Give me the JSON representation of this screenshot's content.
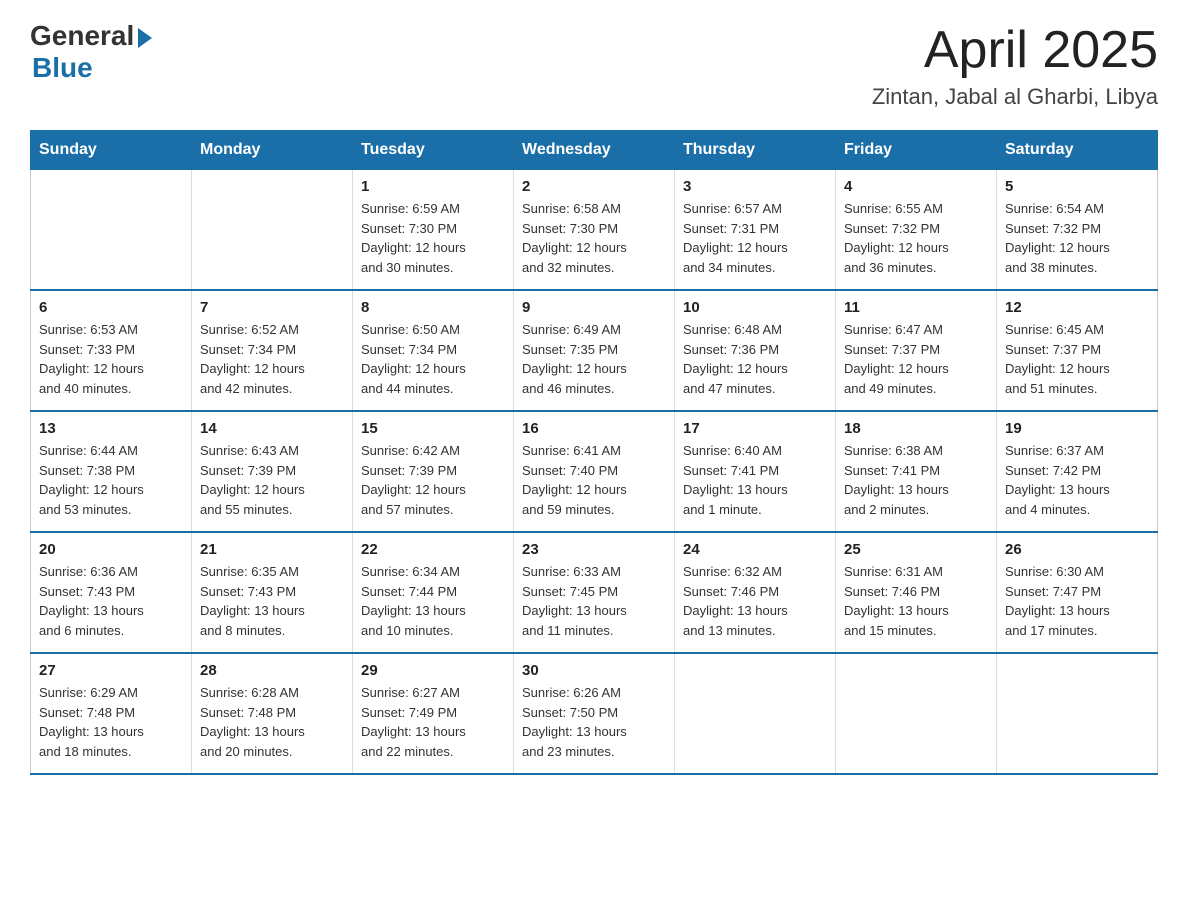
{
  "logo": {
    "general": "General",
    "blue": "Blue"
  },
  "header": {
    "month_year": "April 2025",
    "location": "Zintan, Jabal al Gharbi, Libya"
  },
  "days_of_week": [
    "Sunday",
    "Monday",
    "Tuesday",
    "Wednesday",
    "Thursday",
    "Friday",
    "Saturday"
  ],
  "weeks": [
    [
      {
        "day": "",
        "info": ""
      },
      {
        "day": "",
        "info": ""
      },
      {
        "day": "1",
        "info": "Sunrise: 6:59 AM\nSunset: 7:30 PM\nDaylight: 12 hours\nand 30 minutes."
      },
      {
        "day": "2",
        "info": "Sunrise: 6:58 AM\nSunset: 7:30 PM\nDaylight: 12 hours\nand 32 minutes."
      },
      {
        "day": "3",
        "info": "Sunrise: 6:57 AM\nSunset: 7:31 PM\nDaylight: 12 hours\nand 34 minutes."
      },
      {
        "day": "4",
        "info": "Sunrise: 6:55 AM\nSunset: 7:32 PM\nDaylight: 12 hours\nand 36 minutes."
      },
      {
        "day": "5",
        "info": "Sunrise: 6:54 AM\nSunset: 7:32 PM\nDaylight: 12 hours\nand 38 minutes."
      }
    ],
    [
      {
        "day": "6",
        "info": "Sunrise: 6:53 AM\nSunset: 7:33 PM\nDaylight: 12 hours\nand 40 minutes."
      },
      {
        "day": "7",
        "info": "Sunrise: 6:52 AM\nSunset: 7:34 PM\nDaylight: 12 hours\nand 42 minutes."
      },
      {
        "day": "8",
        "info": "Sunrise: 6:50 AM\nSunset: 7:34 PM\nDaylight: 12 hours\nand 44 minutes."
      },
      {
        "day": "9",
        "info": "Sunrise: 6:49 AM\nSunset: 7:35 PM\nDaylight: 12 hours\nand 46 minutes."
      },
      {
        "day": "10",
        "info": "Sunrise: 6:48 AM\nSunset: 7:36 PM\nDaylight: 12 hours\nand 47 minutes."
      },
      {
        "day": "11",
        "info": "Sunrise: 6:47 AM\nSunset: 7:37 PM\nDaylight: 12 hours\nand 49 minutes."
      },
      {
        "day": "12",
        "info": "Sunrise: 6:45 AM\nSunset: 7:37 PM\nDaylight: 12 hours\nand 51 minutes."
      }
    ],
    [
      {
        "day": "13",
        "info": "Sunrise: 6:44 AM\nSunset: 7:38 PM\nDaylight: 12 hours\nand 53 minutes."
      },
      {
        "day": "14",
        "info": "Sunrise: 6:43 AM\nSunset: 7:39 PM\nDaylight: 12 hours\nand 55 minutes."
      },
      {
        "day": "15",
        "info": "Sunrise: 6:42 AM\nSunset: 7:39 PM\nDaylight: 12 hours\nand 57 minutes."
      },
      {
        "day": "16",
        "info": "Sunrise: 6:41 AM\nSunset: 7:40 PM\nDaylight: 12 hours\nand 59 minutes."
      },
      {
        "day": "17",
        "info": "Sunrise: 6:40 AM\nSunset: 7:41 PM\nDaylight: 13 hours\nand 1 minute."
      },
      {
        "day": "18",
        "info": "Sunrise: 6:38 AM\nSunset: 7:41 PM\nDaylight: 13 hours\nand 2 minutes."
      },
      {
        "day": "19",
        "info": "Sunrise: 6:37 AM\nSunset: 7:42 PM\nDaylight: 13 hours\nand 4 minutes."
      }
    ],
    [
      {
        "day": "20",
        "info": "Sunrise: 6:36 AM\nSunset: 7:43 PM\nDaylight: 13 hours\nand 6 minutes."
      },
      {
        "day": "21",
        "info": "Sunrise: 6:35 AM\nSunset: 7:43 PM\nDaylight: 13 hours\nand 8 minutes."
      },
      {
        "day": "22",
        "info": "Sunrise: 6:34 AM\nSunset: 7:44 PM\nDaylight: 13 hours\nand 10 minutes."
      },
      {
        "day": "23",
        "info": "Sunrise: 6:33 AM\nSunset: 7:45 PM\nDaylight: 13 hours\nand 11 minutes."
      },
      {
        "day": "24",
        "info": "Sunrise: 6:32 AM\nSunset: 7:46 PM\nDaylight: 13 hours\nand 13 minutes."
      },
      {
        "day": "25",
        "info": "Sunrise: 6:31 AM\nSunset: 7:46 PM\nDaylight: 13 hours\nand 15 minutes."
      },
      {
        "day": "26",
        "info": "Sunrise: 6:30 AM\nSunset: 7:47 PM\nDaylight: 13 hours\nand 17 minutes."
      }
    ],
    [
      {
        "day": "27",
        "info": "Sunrise: 6:29 AM\nSunset: 7:48 PM\nDaylight: 13 hours\nand 18 minutes."
      },
      {
        "day": "28",
        "info": "Sunrise: 6:28 AM\nSunset: 7:48 PM\nDaylight: 13 hours\nand 20 minutes."
      },
      {
        "day": "29",
        "info": "Sunrise: 6:27 AM\nSunset: 7:49 PM\nDaylight: 13 hours\nand 22 minutes."
      },
      {
        "day": "30",
        "info": "Sunrise: 6:26 AM\nSunset: 7:50 PM\nDaylight: 13 hours\nand 23 minutes."
      },
      {
        "day": "",
        "info": ""
      },
      {
        "day": "",
        "info": ""
      },
      {
        "day": "",
        "info": ""
      }
    ]
  ]
}
